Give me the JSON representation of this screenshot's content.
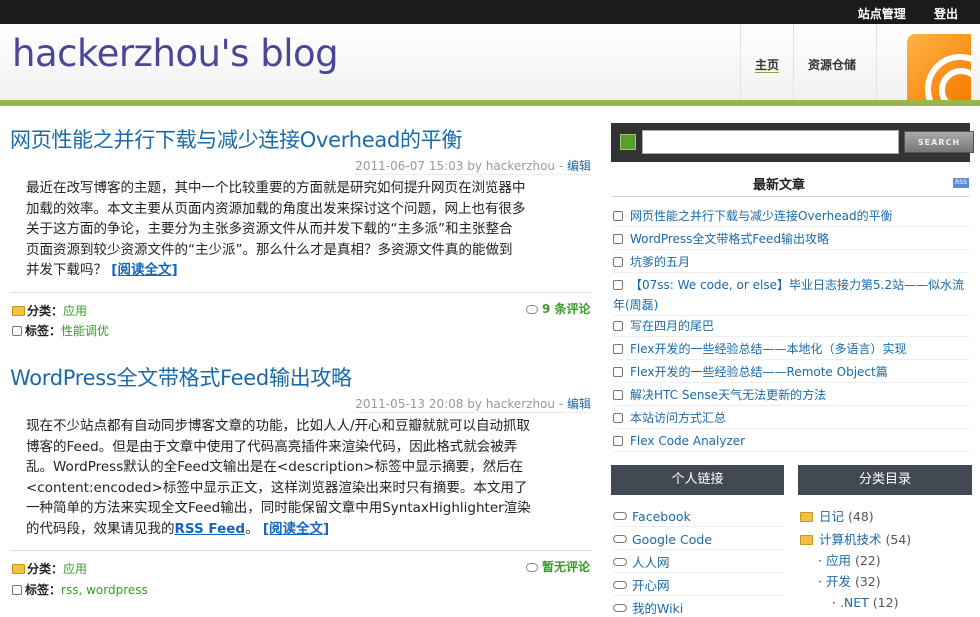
{
  "topbar": {
    "site_admin": "站点管理",
    "logout": "登出"
  },
  "header": {
    "blog_title": "hackerzhou's blog",
    "nav": [
      {
        "label": "主页"
      },
      {
        "label": "资源仓储"
      }
    ]
  },
  "posts": [
    {
      "title": "网页性能之并行下载与减少连接Overhead的平衡",
      "date": "2011-06-07 15:03 by hackerzhou",
      "edit": "编辑",
      "lines": [
        "最近在改写博客的主题，其中一个比较重要的方面就是研究如何提升网页在浏览器中",
        "加载的效率。本文主要从页面内资源加载的角度出发来探讨这个问题，网上也有很多",
        "关于这方面的争论，主要分为主张多资源文件从而并发下载的“主多派”和主张整合",
        "页面资源到较少资源文件的“主少派”。那么什么才是真相？多资源文件真的能做到",
        "并发下载吗？"
      ],
      "read_more": "[阅读全文]",
      "category_label": "分类：",
      "category": "应用",
      "tags_label": "标签：",
      "tags": "性能调优",
      "comments": "9 条评论"
    },
    {
      "title": "WordPress全文带格式Feed输出攻略",
      "date": "2011-05-13 20:08 by hackerzhou",
      "edit": "编辑",
      "lines": [
        "现在不少站点都有自动同步博客文章的功能，比如人人/开心和豆瓣就就可以自动抓取",
        "博客的Feed。但是由于文章中使用了代码高亮插件来渲染代码，因此格式就会被弄",
        "乱。WordPress默认的全Feed文输出是在<description>标签中显示摘要，然后在",
        "<content:encoded>标签中显示正文，这样浏览器渲染出来时只有摘要。本文用了",
        "一种简单的方法来实现全文Feed输出，同时能保留文章中用SyntaxHighlighter渲染",
        "的代码段，效果请见我的"
      ],
      "rss_link": "RSS Feed",
      "after_link": "。",
      "read_more": "[阅读全文]",
      "category_label": "分类：",
      "category": "应用",
      "tags_label": "标签：",
      "tags": "rss, wordpress",
      "comments": "暂无评论"
    }
  ],
  "sidebar": {
    "search": {
      "placeholder": "",
      "button": "SEARCH"
    },
    "recent_title": "最新文章",
    "rss_badge": "RSS",
    "recent": [
      "网页性能之并行下载与减少连接Overhead的平衡",
      "WordPress全文带格式Feed输出攻略",
      "坑爹的五月",
      "【07ss: We code, or else】毕业日志接力第5.2站——似水流",
      "年(周磊)",
      "写在四月的尾巴",
      "Flex开发的一些经验总结——本地化（多语言）实现",
      "Flex开发的一些经验总结——Remote Object篇",
      "解决HTC Sense天气无法更新的方法",
      "本站访问方式汇总",
      "Flex Code Analyzer"
    ],
    "links_title": "个人链接",
    "links": [
      "Facebook",
      "Google Code",
      "人人网",
      "开心网",
      "我的Wiki"
    ],
    "categories_title": "分类目录",
    "categories": [
      {
        "name": "日记",
        "count": "(48)"
      },
      {
        "name": "计算机技术",
        "count": "(54)"
      },
      {
        "name": "应用",
        "count": "(22)"
      },
      {
        "name": "开发",
        "count": "(32)"
      },
      {
        "name": ".NET",
        "count": "(12)"
      }
    ]
  }
}
